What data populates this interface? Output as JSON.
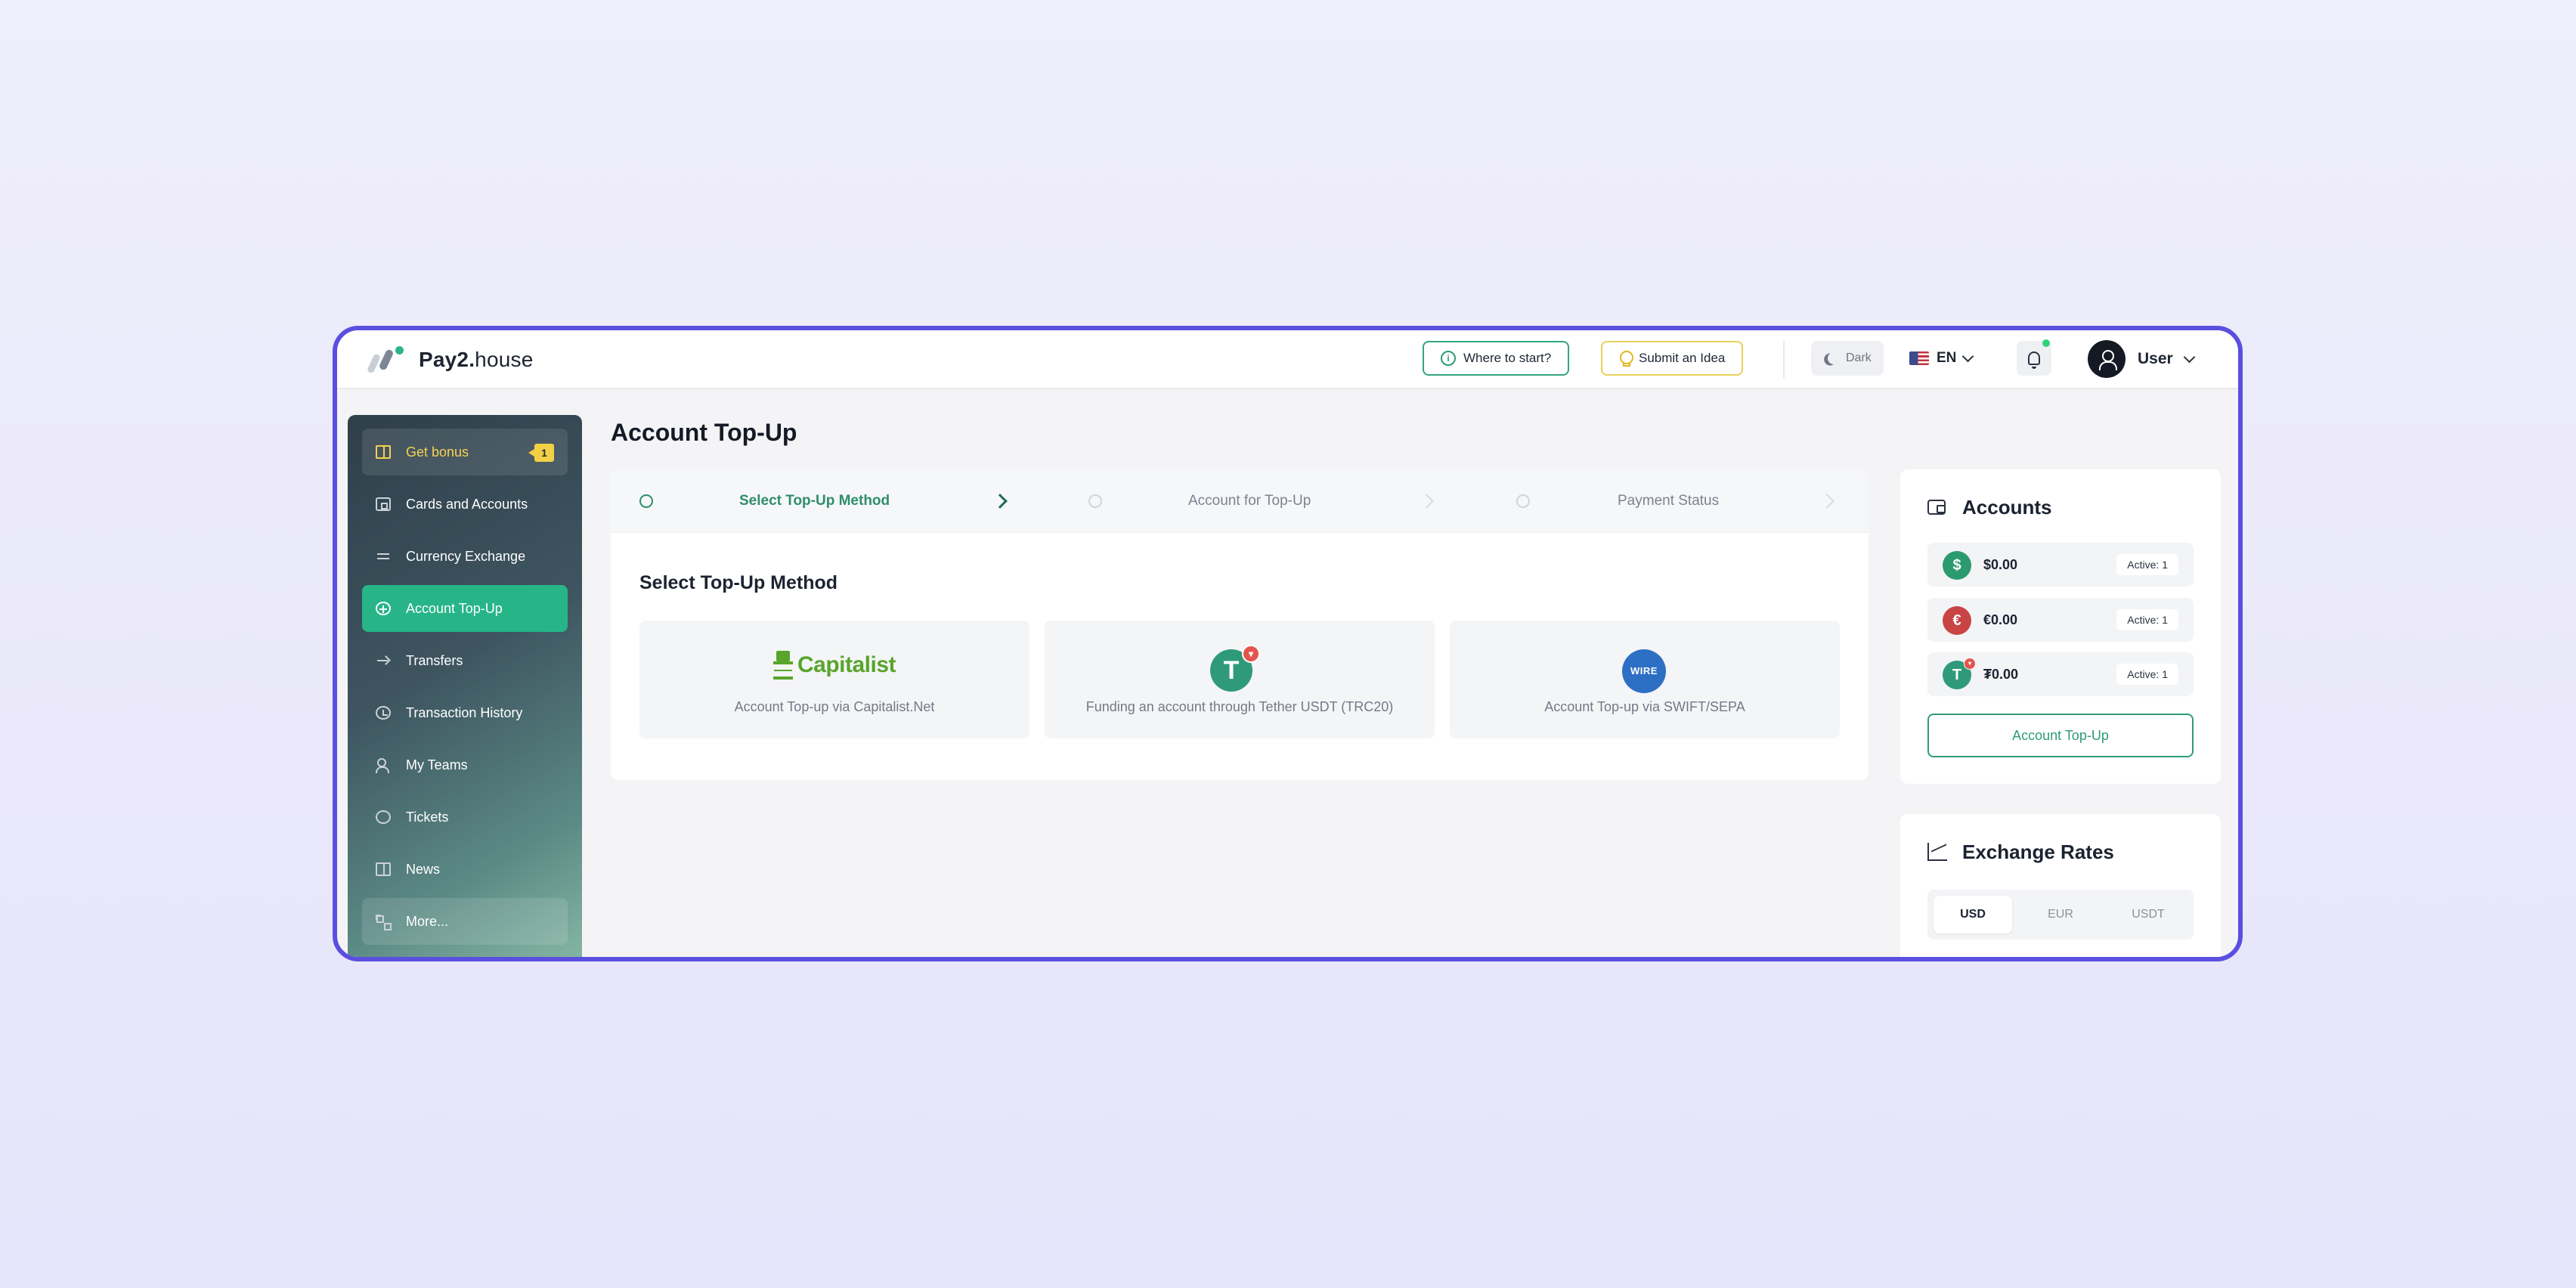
{
  "brand": {
    "name_bold": "Pay2.",
    "name_light": "house"
  },
  "header": {
    "where_to_start": "Where to start?",
    "submit_idea": "Submit an Idea",
    "theme_toggle": "Dark",
    "language": "EN",
    "user_name": "User"
  },
  "sidebar": {
    "items": [
      {
        "label": "Get bonus",
        "icon": "gift-icon",
        "badge": "1"
      },
      {
        "label": "Cards and Accounts",
        "icon": "wallet-icon"
      },
      {
        "label": "Currency Exchange",
        "icon": "swap-icon"
      },
      {
        "label": "Account Top-Up",
        "icon": "plus-circle-icon",
        "active": true
      },
      {
        "label": "Transfers",
        "icon": "arrow-right-icon"
      },
      {
        "label": "Transaction History",
        "icon": "clock-icon"
      },
      {
        "label": "My Teams",
        "icon": "team-icon"
      },
      {
        "label": "Tickets",
        "icon": "chat-icon"
      },
      {
        "label": "News",
        "icon": "book-icon"
      },
      {
        "label": "More...",
        "icon": "grid-icon"
      }
    ]
  },
  "main": {
    "title": "Account Top-Up",
    "steps": [
      {
        "label": "Select Top-Up Method",
        "active": true
      },
      {
        "label": "Account for Top-Up",
        "active": false
      },
      {
        "label": "Payment Status",
        "active": false
      }
    ],
    "section_title": "Select Top-Up Method",
    "methods": [
      {
        "logo_text": "Capitalist",
        "label": "Account Top-up via Capitalist.Net"
      },
      {
        "logo_text": "T",
        "label": "Funding an account through Tether USDT (TRC20)"
      },
      {
        "logo_text": "WIRE",
        "label": "Account Top-up via SWIFT/SEPA"
      }
    ]
  },
  "accounts": {
    "title": "Accounts",
    "rows": [
      {
        "symbol": "$",
        "amount": "$0.00",
        "status": "Active: 1"
      },
      {
        "symbol": "€",
        "amount": "€0.00",
        "status": "Active: 1"
      },
      {
        "symbol": "T",
        "amount": "₮0.00",
        "status": "Active: 1"
      }
    ],
    "topup_button": "Account Top-Up"
  },
  "exchange_rates": {
    "title": "Exchange Rates",
    "tabs": [
      "USD",
      "EUR",
      "USDT"
    ],
    "selected": "USD"
  },
  "colors": {
    "accent": "#27b587",
    "frame": "#5b4fe0",
    "bonus": "#f3d253"
  }
}
